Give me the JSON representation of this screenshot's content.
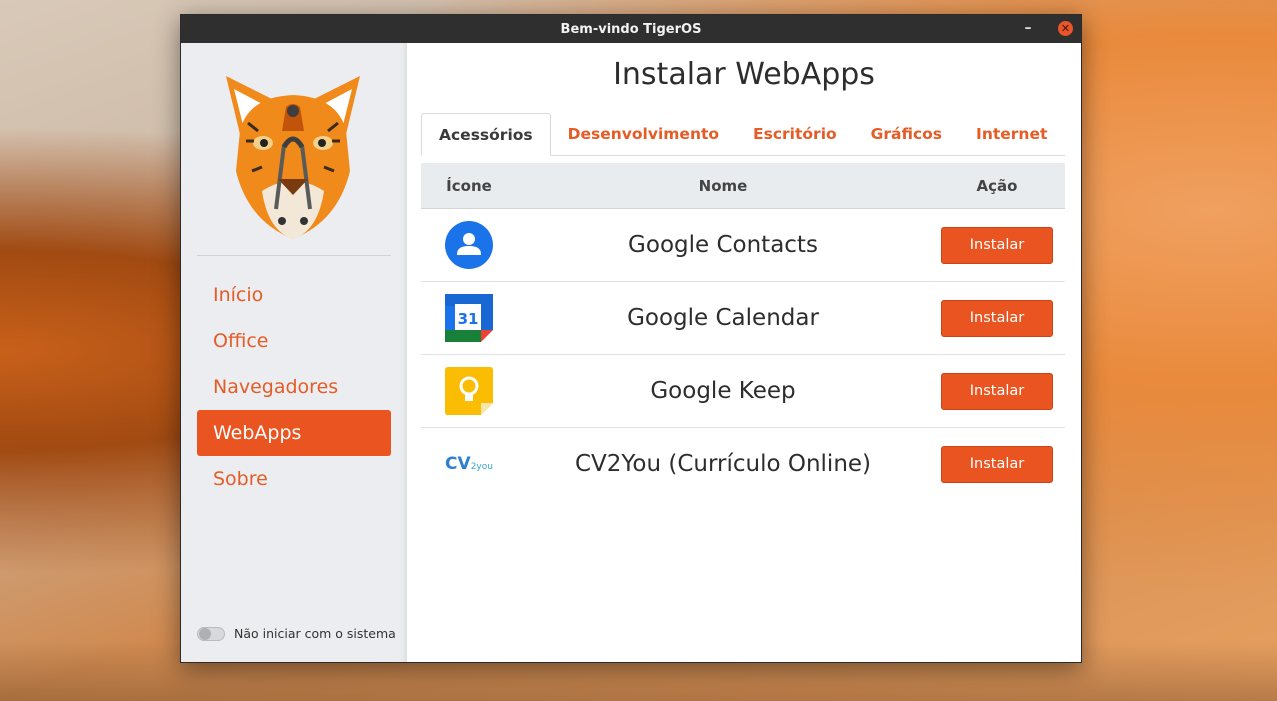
{
  "window": {
    "title": "Bem-vindo TigerOS"
  },
  "sidebar": {
    "items": [
      {
        "label": "Início",
        "active": false
      },
      {
        "label": "Office",
        "active": false
      },
      {
        "label": "Navegadores",
        "active": false
      },
      {
        "label": "WebApps",
        "active": true
      },
      {
        "label": "Sobre",
        "active": false
      }
    ],
    "toggle_label": "Não iniciar com o sistema",
    "toggle_on": false
  },
  "main": {
    "title": "Instalar WebApps",
    "tabs": [
      {
        "label": "Acessórios",
        "active": true
      },
      {
        "label": "Desenvolvimento",
        "active": false
      },
      {
        "label": "Escritório",
        "active": false
      },
      {
        "label": "Gráficos",
        "active": false
      },
      {
        "label": "Internet",
        "active": false
      }
    ],
    "table": {
      "headers": {
        "icon": "Ícone",
        "name": "Nome",
        "action": "Ação"
      },
      "rows": [
        {
          "icon": "google-contacts-icon",
          "name": "Google Contacts",
          "button": "Instalar"
        },
        {
          "icon": "google-calendar-icon",
          "name": "Google Calendar",
          "button": "Instalar",
          "icon_text": "31"
        },
        {
          "icon": "google-keep-icon",
          "name": "Google Keep",
          "button": "Instalar"
        },
        {
          "icon": "cv2you-logo",
          "name": "CV2You (Currículo Online)",
          "button": "Instalar",
          "logo_main": "CV",
          "logo_small": "2you"
        }
      ]
    }
  },
  "colors": {
    "accent": "#e95420",
    "titlebar": "#2f2f2f",
    "sidebar_bg": "#ebedf0"
  }
}
